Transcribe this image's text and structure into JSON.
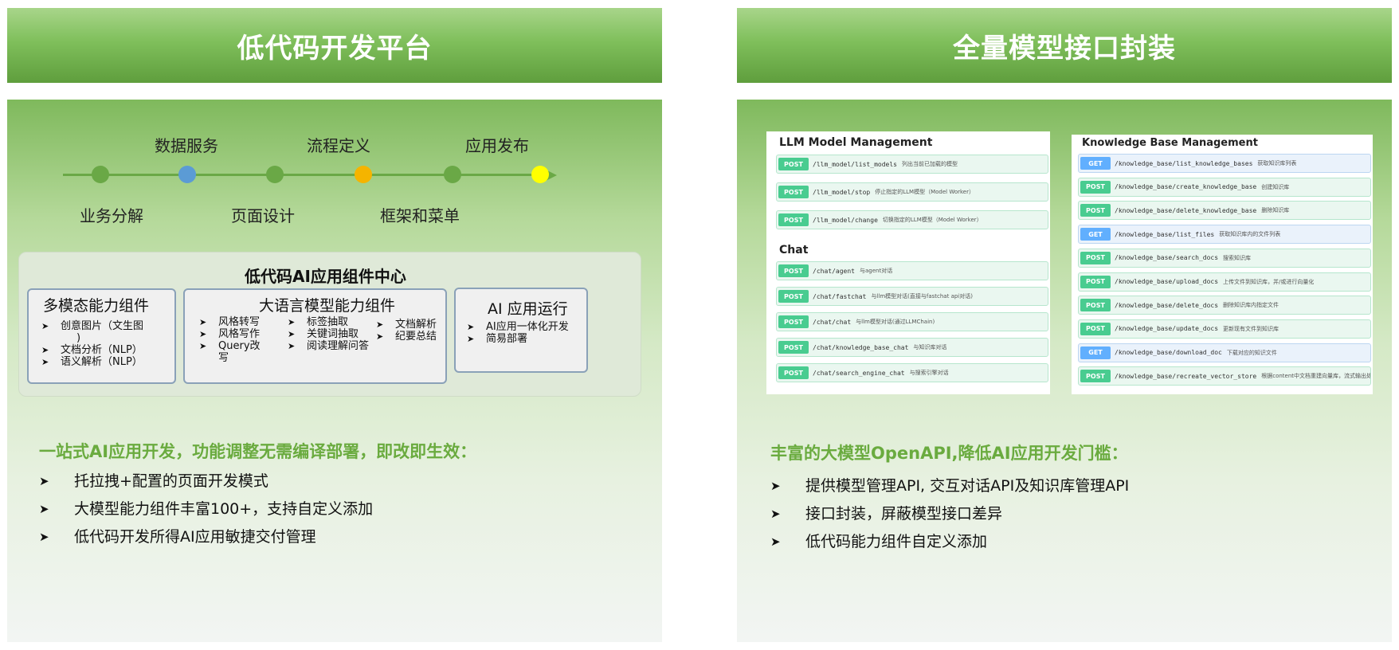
{
  "left": {
    "title": "低代码开发平台",
    "timeline": {
      "top_labels": [
        "数据服务",
        "流程定义",
        "应用发布"
      ],
      "bottom_labels": [
        "业务分解",
        "页面设计",
        "框架和菜单"
      ],
      "dot_colors": [
        "#6aa846",
        "#5b9bd5",
        "#6aa846",
        "#f5b400",
        "#6aa846",
        "#ffff00"
      ]
    },
    "center": {
      "title": "低代码AI应用组件中心",
      "multimodal": {
        "title": "多模态能力组件",
        "items": [
          "创意图片（文生图",
          ")",
          "文档分析（NLP）",
          "语义解析（NLP）"
        ]
      },
      "llm": {
        "title": "大语言模型能力组件",
        "col1": [
          "风格转写",
          "风格写作",
          "Query改",
          "写"
        ],
        "col2": [
          "标签抽取",
          "关键词抽取",
          "阅读理解问答"
        ],
        "col3": [
          "文档解析",
          "纪要总结"
        ]
      },
      "runtime": {
        "title": "AI 应用运行",
        "items": [
          "AI应用一体化开发",
          "简易部署"
        ]
      }
    },
    "headline": "一站式AI应用开发，功能调整无需编译部署，即改即生效：",
    "features": [
      "托拉拽+配置的页面开发模式",
      "大模型能力组件丰富100+，支持自定义添加",
      "低代码开发所得AI应用敏捷交付管理"
    ]
  },
  "right": {
    "title": "全量模型接口封装",
    "llm_card": {
      "section1": "LLM Model Management",
      "rows1": [
        {
          "method": "POST",
          "path": "/llm_model/list_models",
          "desc": "列出当前已加载的模型"
        },
        {
          "method": "POST",
          "path": "/llm_model/stop",
          "desc": "停止指定的LLM模型（Model Worker）"
        },
        {
          "method": "POST",
          "path": "/llm_model/change",
          "desc": "切换指定的LLM模型（Model Worker）"
        }
      ],
      "section2": "Chat",
      "rows2": [
        {
          "method": "POST",
          "path": "/chat/agent",
          "desc": "与agent对话"
        },
        {
          "method": "POST",
          "path": "/chat/fastchat",
          "desc": "与llm模型对话(直接与fastchat api对话)"
        },
        {
          "method": "POST",
          "path": "/chat/chat",
          "desc": "与llm模型对话(通过LLMChain)"
        },
        {
          "method": "POST",
          "path": "/chat/knowledge_base_chat",
          "desc": "与知识库对话"
        },
        {
          "method": "POST",
          "path": "/chat/search_engine_chat",
          "desc": "与搜索引擎对话"
        }
      ]
    },
    "kb_card": {
      "section": "Knowledge Base Management",
      "rows": [
        {
          "method": "GET",
          "path": "/knowledge_base/list_knowledge_bases",
          "desc": "获取知识库列表"
        },
        {
          "method": "POST",
          "path": "/knowledge_base/create_knowledge_base",
          "desc": "创建知识库"
        },
        {
          "method": "POST",
          "path": "/knowledge_base/delete_knowledge_base",
          "desc": "删除知识库"
        },
        {
          "method": "GET",
          "path": "/knowledge_base/list_files",
          "desc": "获取知识库内的文件列表"
        },
        {
          "method": "POST",
          "path": "/knowledge_base/search_docs",
          "desc": "搜索知识库"
        },
        {
          "method": "POST",
          "path": "/knowledge_base/upload_docs",
          "desc": "上传文件到知识库，并/或进行向量化"
        },
        {
          "method": "POST",
          "path": "/knowledge_base/delete_docs",
          "desc": "删除知识库内指定文件"
        },
        {
          "method": "POST",
          "path": "/knowledge_base/update_docs",
          "desc": "更新现有文件到知识库"
        },
        {
          "method": "GET",
          "path": "/knowledge_base/download_doc",
          "desc": "下载对应的知识文件"
        },
        {
          "method": "POST",
          "path": "/knowledge_base/recreate_vector_store",
          "desc": "根据content中文档重建向量库，流式输出处理进度。"
        }
      ]
    },
    "headline": "丰富的大模型OpenAPI,降低AI应用开发门槛：",
    "features": [
      "提供模型管理API, 交互对话API及知识库管理API",
      "接口封装，屏蔽模型接口差异",
      "低代码能力组件自定义添加"
    ]
  }
}
